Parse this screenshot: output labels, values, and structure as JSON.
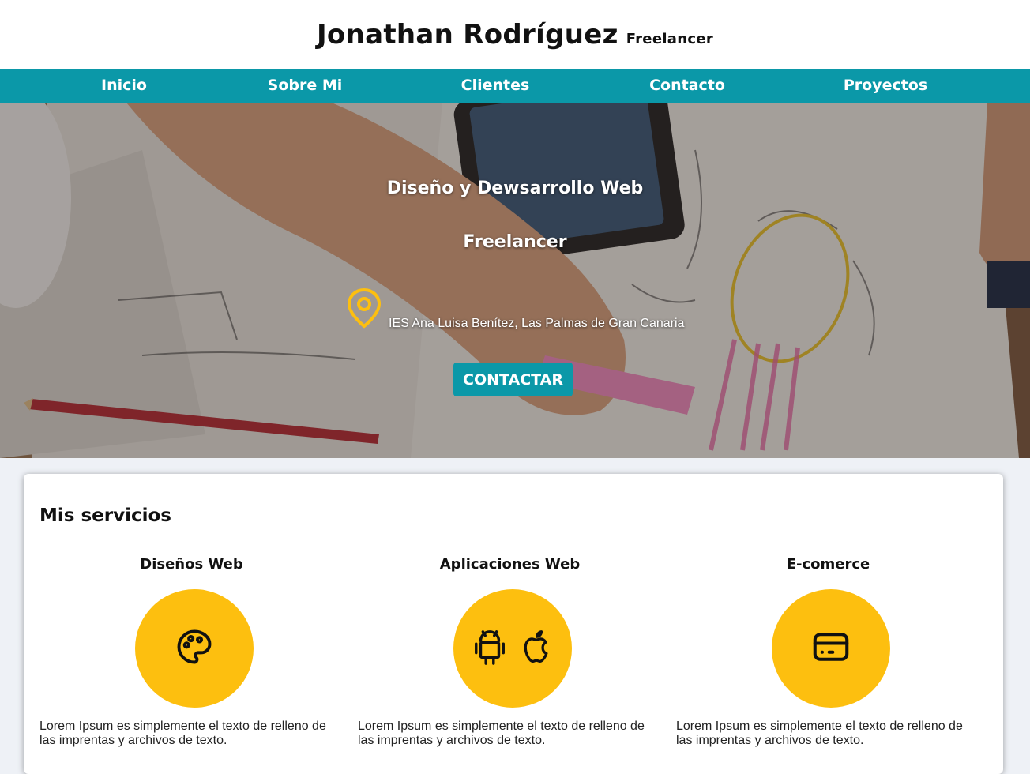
{
  "header": {
    "name": "Jonathan Rodríguez",
    "role": "Freelancer"
  },
  "nav": {
    "items": [
      "Inicio",
      "Sobre Mi",
      "Clientes",
      "Contacto",
      "Proyectos"
    ]
  },
  "hero": {
    "heading": "Diseño y Dewsarrollo Web",
    "subheading": "Freelancer",
    "location_icon": "map-pin-icon",
    "location": "IES Ana Luisa Benítez, Las Palmas de Gran Canaria",
    "cta_label": "CONTACTAR"
  },
  "services": {
    "title": "Mis servicios",
    "items": [
      {
        "title": "Diseños Web",
        "icons": [
          "palette-icon"
        ],
        "text": "Lorem Ipsum es simplemente el texto de relleno de las imprentas y archivos de texto."
      },
      {
        "title": "Aplicaciones Web",
        "icons": [
          "android-icon",
          "apple-icon"
        ],
        "text": "Lorem Ipsum es simplemente el texto de relleno de las imprentas y archivos de texto."
      },
      {
        "title": "E-comerce",
        "icons": [
          "credit-card-icon"
        ],
        "text": "Lorem Ipsum es simplemente el texto de relleno de las imprentas y archivos de texto."
      }
    ]
  },
  "colors": {
    "accent": "#0b98a8",
    "service_circle": "#fdbf0f",
    "pin": "#fdbf0f"
  }
}
